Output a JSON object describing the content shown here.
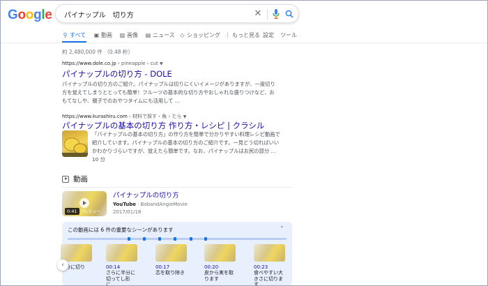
{
  "logo": {
    "letters": [
      "G",
      "o",
      "o",
      "g",
      "l",
      "e"
    ],
    "colors": [
      "#4285f4",
      "#ea4335",
      "#fbbc05",
      "#4285f4",
      "#34a853",
      "#ea4335"
    ]
  },
  "search": {
    "query": "パイナップル　切り方"
  },
  "tabs": [
    {
      "label": "すべて",
      "icon": "search-icon"
    },
    {
      "label": "動画",
      "icon": "video-icon"
    },
    {
      "label": "画像",
      "icon": "image-icon"
    },
    {
      "label": "ニュース",
      "icon": "news-icon"
    },
    {
      "label": "ショッピング",
      "icon": "tag-icon"
    },
    {
      "label": "もっと見る",
      "icon": "more-icon"
    },
    {
      "label": "設定",
      "icon": ""
    },
    {
      "label": "ツール",
      "icon": ""
    }
  ],
  "stats": "約 2,480,000 件 （0.48 秒）",
  "results": [
    {
      "cite_domain": "https://www.dole.co.jp",
      "cite_path": " › pineapple › cut ",
      "title": "パイナップルの切り方 - DOLE",
      "snippet": [
        "パイナップルの切り方のご紹介。パイナップルは切りにくいイメージがありますが、一度切り",
        "方を覚えてしまうととっても簡単！フルーツの基本的な切り方やおしゃれな盛りつけなど、お",
        "もてなしや、親子でのおやつタイムにも活用して ..."
      ]
    },
    {
      "cite_domain": "https://www.kurashiru.com",
      "cite_path": " › 材料で探す › 魚 › たら ",
      "title": "パイナップルの基本の切り方 作り方・レシピ | クラシル",
      "snippet": [
        "「パイナップルの基本の切り方」の作り方を簡単で分かりやすい料理レシピ動画で",
        "紹介しています。パイナップルの基本の切り方のご紹介です。一見どう切ればいい",
        "かわかりづらいですが、覚えたら簡単です。なお、パイナップルはお尻の部分 ..."
      ],
      "duration_note": "10 分"
    }
  ],
  "videos": {
    "heading": "動画",
    "items": [
      {
        "title": "パイナップルの切り方",
        "platform": "YouTube",
        "channel": " · BobandAngieMovie",
        "date": "2017/01/18",
        "duration": "0:41",
        "preview": "プレビュー"
      }
    ],
    "key_moments": {
      "label": "この動画には 6 件の重要なシーンがあります",
      "items": [
        {
          "time": "",
          "text": "半分に切り"
        },
        {
          "time": "00:14",
          "text": "さらに半分に切ってし形に..."
        },
        {
          "time": "00:17",
          "text": "芯を取り除き"
        },
        {
          "time": "00:20",
          "text": "皮から実を取ります"
        },
        {
          "time": "00:23",
          "text": "食べやすい大きさに切ります"
        }
      ]
    }
  }
}
